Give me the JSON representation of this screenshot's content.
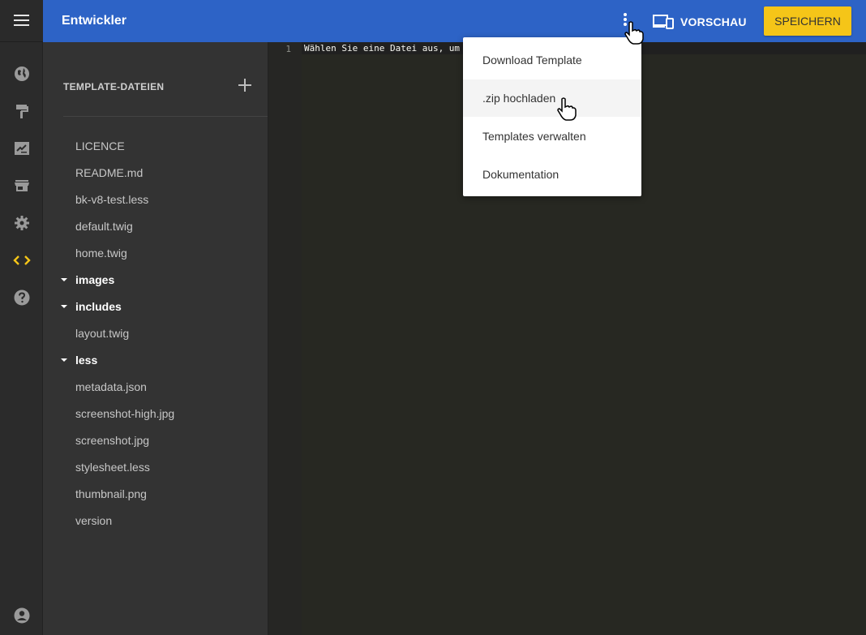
{
  "header": {
    "title": "Entwickler",
    "preview_label": "VORSCHAU",
    "save_label": "SPEICHERN"
  },
  "rail": {
    "icons": [
      "globe-icon",
      "paint-roller-icon",
      "sign-icon",
      "store-icon",
      "gear-icon",
      "code-icon",
      "help-icon",
      "account-icon"
    ],
    "active": "code-icon",
    "active_color": "#f5c518"
  },
  "files": {
    "header": "TEMPLATE-DATEIEN",
    "items": [
      {
        "name": "LICENCE",
        "type": "file"
      },
      {
        "name": "README.md",
        "type": "file"
      },
      {
        "name": "bk-v8-test.less",
        "type": "file"
      },
      {
        "name": "default.twig",
        "type": "file"
      },
      {
        "name": "home.twig",
        "type": "file"
      },
      {
        "name": "images",
        "type": "folder"
      },
      {
        "name": "includes",
        "type": "folder"
      },
      {
        "name": "layout.twig",
        "type": "file"
      },
      {
        "name": "less",
        "type": "folder"
      },
      {
        "name": "metadata.json",
        "type": "file"
      },
      {
        "name": "screenshot-high.jpg",
        "type": "file"
      },
      {
        "name": "screenshot.jpg",
        "type": "file"
      },
      {
        "name": "stylesheet.less",
        "type": "file"
      },
      {
        "name": "thumbnail.png",
        "type": "file"
      },
      {
        "name": "version",
        "type": "file"
      }
    ]
  },
  "editor": {
    "line_number": "1",
    "line_text": "Wählen Sie eine Datei aus, um"
  },
  "menu": {
    "items": [
      {
        "label": "Download Template"
      },
      {
        "label": ".zip hochladen"
      },
      {
        "label": "Templates verwalten"
      },
      {
        "label": "Dokumentation"
      }
    ],
    "hovered": ".zip hochladen"
  },
  "colors": {
    "topbar": "#2d63c6",
    "save_button": "#f5c518",
    "editor_bg": "#272822",
    "sidebar_bg": "#333333"
  }
}
